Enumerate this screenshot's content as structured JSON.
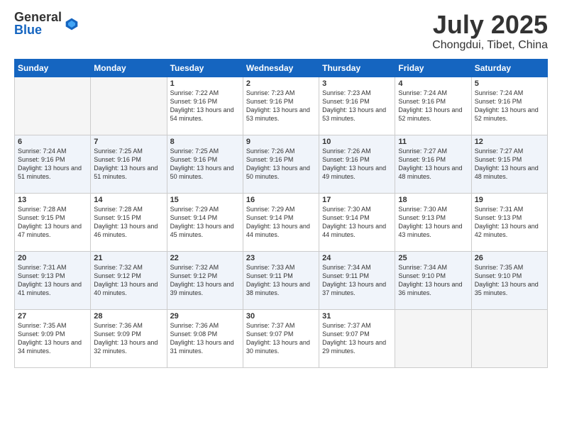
{
  "logo": {
    "general": "General",
    "blue": "Blue"
  },
  "title": "July 2025",
  "subtitle": "Chongdui, Tibet, China",
  "days_of_week": [
    "Sunday",
    "Monday",
    "Tuesday",
    "Wednesday",
    "Thursday",
    "Friday",
    "Saturday"
  ],
  "weeks": [
    [
      {
        "day": "",
        "info": ""
      },
      {
        "day": "",
        "info": ""
      },
      {
        "day": "1",
        "info": "Sunrise: 7:22 AM\nSunset: 9:16 PM\nDaylight: 13 hours and 54 minutes."
      },
      {
        "day": "2",
        "info": "Sunrise: 7:23 AM\nSunset: 9:16 PM\nDaylight: 13 hours and 53 minutes."
      },
      {
        "day": "3",
        "info": "Sunrise: 7:23 AM\nSunset: 9:16 PM\nDaylight: 13 hours and 53 minutes."
      },
      {
        "day": "4",
        "info": "Sunrise: 7:24 AM\nSunset: 9:16 PM\nDaylight: 13 hours and 52 minutes."
      },
      {
        "day": "5",
        "info": "Sunrise: 7:24 AM\nSunset: 9:16 PM\nDaylight: 13 hours and 52 minutes."
      }
    ],
    [
      {
        "day": "6",
        "info": "Sunrise: 7:24 AM\nSunset: 9:16 PM\nDaylight: 13 hours and 51 minutes."
      },
      {
        "day": "7",
        "info": "Sunrise: 7:25 AM\nSunset: 9:16 PM\nDaylight: 13 hours and 51 minutes."
      },
      {
        "day": "8",
        "info": "Sunrise: 7:25 AM\nSunset: 9:16 PM\nDaylight: 13 hours and 50 minutes."
      },
      {
        "day": "9",
        "info": "Sunrise: 7:26 AM\nSunset: 9:16 PM\nDaylight: 13 hours and 50 minutes."
      },
      {
        "day": "10",
        "info": "Sunrise: 7:26 AM\nSunset: 9:16 PM\nDaylight: 13 hours and 49 minutes."
      },
      {
        "day": "11",
        "info": "Sunrise: 7:27 AM\nSunset: 9:16 PM\nDaylight: 13 hours and 48 minutes."
      },
      {
        "day": "12",
        "info": "Sunrise: 7:27 AM\nSunset: 9:15 PM\nDaylight: 13 hours and 48 minutes."
      }
    ],
    [
      {
        "day": "13",
        "info": "Sunrise: 7:28 AM\nSunset: 9:15 PM\nDaylight: 13 hours and 47 minutes."
      },
      {
        "day": "14",
        "info": "Sunrise: 7:28 AM\nSunset: 9:15 PM\nDaylight: 13 hours and 46 minutes."
      },
      {
        "day": "15",
        "info": "Sunrise: 7:29 AM\nSunset: 9:14 PM\nDaylight: 13 hours and 45 minutes."
      },
      {
        "day": "16",
        "info": "Sunrise: 7:29 AM\nSunset: 9:14 PM\nDaylight: 13 hours and 44 minutes."
      },
      {
        "day": "17",
        "info": "Sunrise: 7:30 AM\nSunset: 9:14 PM\nDaylight: 13 hours and 44 minutes."
      },
      {
        "day": "18",
        "info": "Sunrise: 7:30 AM\nSunset: 9:13 PM\nDaylight: 13 hours and 43 minutes."
      },
      {
        "day": "19",
        "info": "Sunrise: 7:31 AM\nSunset: 9:13 PM\nDaylight: 13 hours and 42 minutes."
      }
    ],
    [
      {
        "day": "20",
        "info": "Sunrise: 7:31 AM\nSunset: 9:13 PM\nDaylight: 13 hours and 41 minutes."
      },
      {
        "day": "21",
        "info": "Sunrise: 7:32 AM\nSunset: 9:12 PM\nDaylight: 13 hours and 40 minutes."
      },
      {
        "day": "22",
        "info": "Sunrise: 7:32 AM\nSunset: 9:12 PM\nDaylight: 13 hours and 39 minutes."
      },
      {
        "day": "23",
        "info": "Sunrise: 7:33 AM\nSunset: 9:11 PM\nDaylight: 13 hours and 38 minutes."
      },
      {
        "day": "24",
        "info": "Sunrise: 7:34 AM\nSunset: 9:11 PM\nDaylight: 13 hours and 37 minutes."
      },
      {
        "day": "25",
        "info": "Sunrise: 7:34 AM\nSunset: 9:10 PM\nDaylight: 13 hours and 36 minutes."
      },
      {
        "day": "26",
        "info": "Sunrise: 7:35 AM\nSunset: 9:10 PM\nDaylight: 13 hours and 35 minutes."
      }
    ],
    [
      {
        "day": "27",
        "info": "Sunrise: 7:35 AM\nSunset: 9:09 PM\nDaylight: 13 hours and 34 minutes."
      },
      {
        "day": "28",
        "info": "Sunrise: 7:36 AM\nSunset: 9:09 PM\nDaylight: 13 hours and 32 minutes."
      },
      {
        "day": "29",
        "info": "Sunrise: 7:36 AM\nSunset: 9:08 PM\nDaylight: 13 hours and 31 minutes."
      },
      {
        "day": "30",
        "info": "Sunrise: 7:37 AM\nSunset: 9:07 PM\nDaylight: 13 hours and 30 minutes."
      },
      {
        "day": "31",
        "info": "Sunrise: 7:37 AM\nSunset: 9:07 PM\nDaylight: 13 hours and 29 minutes."
      },
      {
        "day": "",
        "info": ""
      },
      {
        "day": "",
        "info": ""
      }
    ]
  ]
}
